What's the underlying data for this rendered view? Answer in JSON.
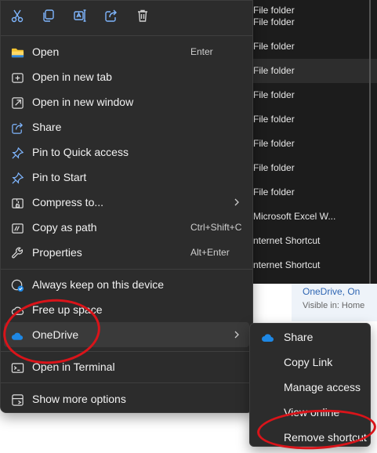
{
  "background": {
    "rows": [
      {
        "label": "File folder",
        "selected": false
      },
      {
        "label": "File folder",
        "selected": false
      },
      {
        "label": "File folder",
        "selected": false
      },
      {
        "label": "File folder",
        "selected": true
      },
      {
        "label": "File folder",
        "selected": false
      },
      {
        "label": "File folder",
        "selected": false
      },
      {
        "label": "File folder",
        "selected": false
      },
      {
        "label": "File folder",
        "selected": false
      },
      {
        "label": "File folder",
        "selected": false
      },
      {
        "label": "Microsoft Excel W...",
        "selected": false
      },
      {
        "label": "nternet Shortcut",
        "selected": false
      },
      {
        "label": "nternet Shortcut",
        "selected": false
      }
    ],
    "details_title": "OneDrive, On",
    "details_sub": "Visible in: Home"
  },
  "toolbar": {
    "buttons": [
      {
        "name": "cut-icon"
      },
      {
        "name": "copy-icon"
      },
      {
        "name": "rename-icon"
      },
      {
        "name": "share-icon"
      },
      {
        "name": "delete-icon"
      }
    ]
  },
  "menu": {
    "items": [
      {
        "label": "Open",
        "shortcut": "Enter",
        "icon": "folder-icon"
      },
      {
        "label": "Open in new tab",
        "shortcut": "",
        "icon": "new-tab-icon"
      },
      {
        "label": "Open in new window",
        "shortcut": "",
        "icon": "new-window-icon"
      },
      {
        "label": "Share",
        "shortcut": "",
        "icon": "share-icon"
      },
      {
        "label": "Pin to Quick access",
        "shortcut": "",
        "icon": "pin-icon"
      },
      {
        "label": "Pin to Start",
        "shortcut": "",
        "icon": "pin-icon"
      },
      {
        "label": "Compress to...",
        "shortcut": "",
        "icon": "zip-icon",
        "submenu": true
      },
      {
        "label": "Copy as path",
        "shortcut": "Ctrl+Shift+C",
        "icon": "copy-path-icon"
      },
      {
        "label": "Properties",
        "shortcut": "Alt+Enter",
        "icon": "wrench-icon"
      },
      {
        "label": "Always keep on this device",
        "shortcut": "",
        "icon": "keep-on-device-icon"
      },
      {
        "label": "Free up space",
        "shortcut": "",
        "icon": "cloud-outline-icon"
      },
      {
        "label": "OneDrive",
        "shortcut": "",
        "icon": "onedrive-icon",
        "submenu": true,
        "hovered": true
      },
      {
        "label": "Open in Terminal",
        "shortcut": "",
        "icon": "terminal-icon"
      },
      {
        "label": "Show more options",
        "shortcut": "",
        "icon": "more-options-icon"
      }
    ]
  },
  "submenu": {
    "items": [
      {
        "label": "Share",
        "icon": "onedrive-icon"
      },
      {
        "label": "Copy Link"
      },
      {
        "label": "Manage access"
      },
      {
        "label": "View online"
      },
      {
        "label": "Remove shortcut"
      }
    ]
  },
  "colors": {
    "menu_bg": "#2c2c2c",
    "hover_bg": "#3a3a3a",
    "onedrive_blue": "#1e88e5",
    "annotation_red": "#d9141a",
    "folder_yellow": "#f4c430"
  }
}
